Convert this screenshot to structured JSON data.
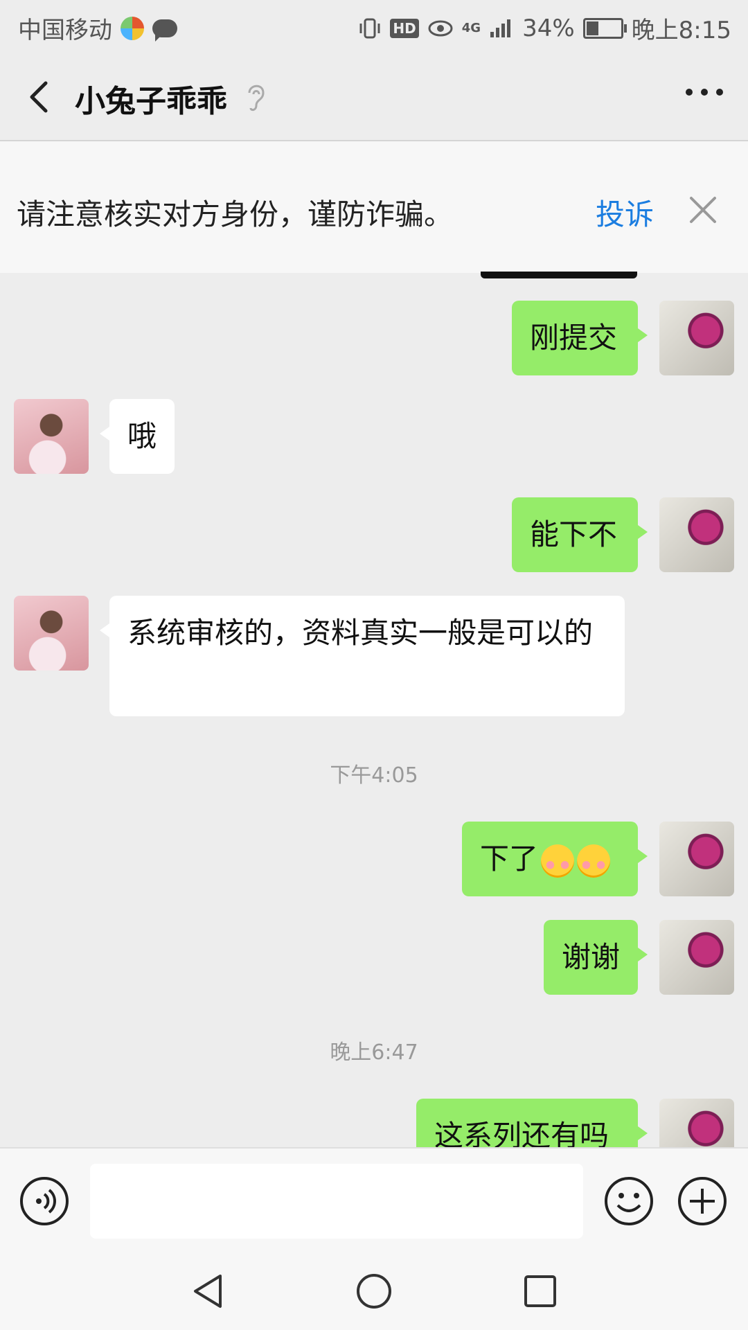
{
  "status_bar": {
    "carrier": "中国移动",
    "network": "4G",
    "battery": "34%",
    "time": "晚上8:15",
    "hd_label": "HD"
  },
  "header": {
    "title": "小兔子乖乖"
  },
  "banner": {
    "message": "请注意核实对方身份，谨防诈骗。",
    "report_label": "投诉"
  },
  "messages": [
    {
      "side": "right",
      "text": "刚提交"
    },
    {
      "side": "left",
      "text": "哦"
    },
    {
      "side": "right",
      "text": "能下不"
    },
    {
      "side": "left",
      "text": "系统审核的，资料真实一般是可以的"
    },
    {
      "side": "right",
      "text": "下了"
    },
    {
      "side": "right",
      "text": "谢谢"
    },
    {
      "side": "right",
      "text": "这系列还有吗"
    }
  ],
  "timestamps": [
    "下午4:05",
    "晚上6:47"
  ],
  "colors": {
    "background": "#ededed",
    "sent_bubble": "#95ec69",
    "received_bubble": "#ffffff",
    "link_blue": "#1b7de0"
  },
  "icons": [
    "back-icon",
    "ear-icon",
    "more-icon",
    "close-icon",
    "voice-icon",
    "emoji-icon",
    "plus-icon",
    "nav-back-icon",
    "nav-home-icon",
    "nav-recents-icon"
  ]
}
